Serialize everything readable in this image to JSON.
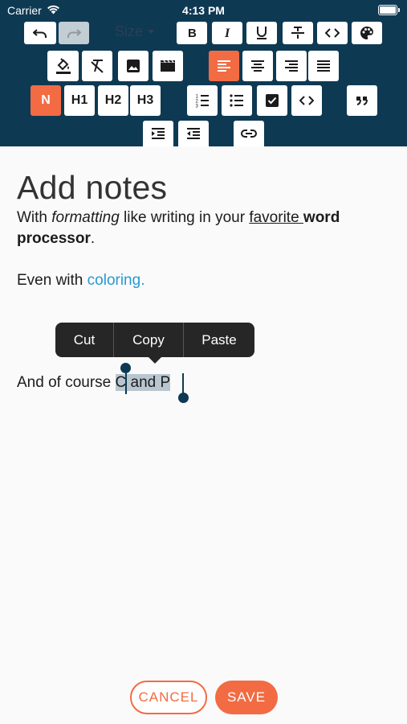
{
  "status_bar": {
    "carrier": "Carrier",
    "time": "4:13 PM",
    "wifi_icon": "wifi-icon",
    "battery_icon": "battery-icon"
  },
  "toolbar": {
    "size_label": "Size",
    "normal_label": "N",
    "h1_label": "H1",
    "h2_label": "H2",
    "h3_label": "H3",
    "active_color": "#f26b43",
    "background_color": "#0e3953",
    "icons": [
      "undo-icon",
      "redo-icon",
      "bold-icon",
      "italic-icon",
      "underline-icon",
      "strikethrough-icon",
      "code-icon",
      "palette-icon",
      "fill-color-icon",
      "clear-format-icon",
      "image-icon",
      "video-icon",
      "align-left-icon",
      "align-center-icon",
      "align-right-icon",
      "align-justify-icon",
      "ordered-list-icon",
      "bullet-list-icon",
      "checklist-icon",
      "code-block-icon",
      "quote-icon",
      "indent-icon",
      "outdent-icon",
      "link-icon"
    ]
  },
  "editor": {
    "title": "Add notes",
    "p1": {
      "before": "With ",
      "italic": "formatting",
      "middle": " like writing in your ",
      "underline": "favorite ",
      "bold1": "word",
      "bold2": "processor",
      "end": "."
    },
    "p2": {
      "before": "Even with ",
      "colored": "coloring.",
      "accent_color": "#2b98d1"
    },
    "p3": {
      "before": "And of course ",
      "selected": "C and P"
    }
  },
  "context_menu": {
    "cut": "Cut",
    "copy": "Copy",
    "paste": "Paste"
  },
  "actions": {
    "cancel": "CANCEL",
    "save": "SAVE"
  }
}
